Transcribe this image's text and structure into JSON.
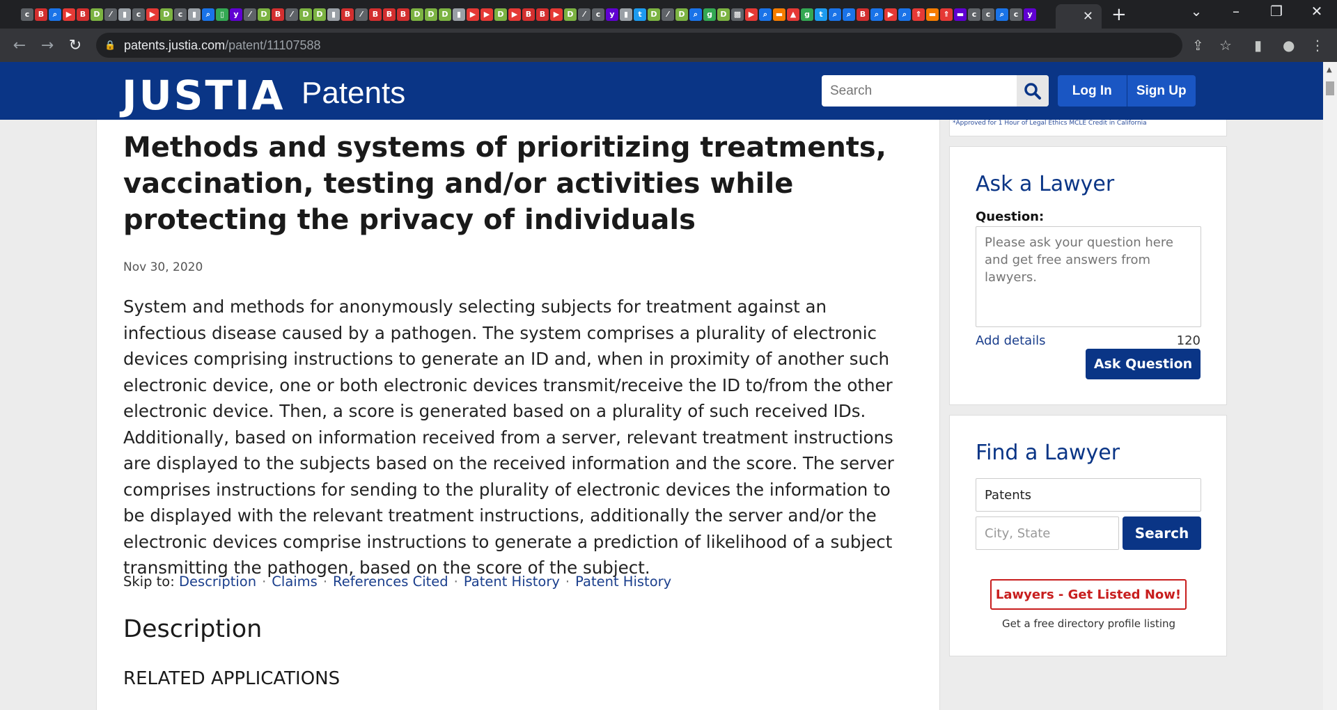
{
  "browser": {
    "tab_icons": [
      {
        "glyph": "c",
        "color": "#5f6368"
      },
      {
        "glyph": "B",
        "color": "#d32f2f"
      },
      {
        "glyph": "⌕",
        "color": "#1a73e8"
      },
      {
        "glyph": "▶",
        "color": "#e53935"
      },
      {
        "glyph": "B",
        "color": "#d32f2f"
      },
      {
        "glyph": "D",
        "color": "#7cb342"
      },
      {
        "glyph": "⁄",
        "color": "#5f6368"
      },
      {
        "glyph": "▮",
        "color": "#9aa0a6"
      },
      {
        "glyph": "c",
        "color": "#5f6368"
      },
      {
        "glyph": "▶",
        "color": "#e53935"
      },
      {
        "glyph": "D",
        "color": "#7cb342"
      },
      {
        "glyph": "c",
        "color": "#5f6368"
      },
      {
        "glyph": "▮",
        "color": "#9aa0a6"
      },
      {
        "glyph": "⌕",
        "color": "#1a73e8"
      },
      {
        "glyph": "▯",
        "color": "#34a853"
      },
      {
        "glyph": "y",
        "color": "#6001d2"
      },
      {
        "glyph": "⁄",
        "color": "#5f6368"
      },
      {
        "glyph": "D",
        "color": "#7cb342"
      },
      {
        "glyph": "B",
        "color": "#d32f2f"
      },
      {
        "glyph": "⁄",
        "color": "#5f6368"
      },
      {
        "glyph": "D",
        "color": "#7cb342"
      },
      {
        "glyph": "D",
        "color": "#7cb342"
      },
      {
        "glyph": "▮",
        "color": "#9aa0a6"
      },
      {
        "glyph": "B",
        "color": "#d32f2f"
      },
      {
        "glyph": "⁄",
        "color": "#5f6368"
      },
      {
        "glyph": "B",
        "color": "#d32f2f"
      },
      {
        "glyph": "B",
        "color": "#d32f2f"
      },
      {
        "glyph": "B",
        "color": "#d32f2f"
      },
      {
        "glyph": "D",
        "color": "#7cb342"
      },
      {
        "glyph": "D",
        "color": "#7cb342"
      },
      {
        "glyph": "D",
        "color": "#7cb342"
      },
      {
        "glyph": "▮",
        "color": "#9aa0a6"
      },
      {
        "glyph": "▶",
        "color": "#e53935"
      },
      {
        "glyph": "▶",
        "color": "#e53935"
      },
      {
        "glyph": "D",
        "color": "#7cb342"
      },
      {
        "glyph": "▶",
        "color": "#e53935"
      },
      {
        "glyph": "B",
        "color": "#d32f2f"
      },
      {
        "glyph": "B",
        "color": "#d32f2f"
      },
      {
        "glyph": "▶",
        "color": "#e53935"
      },
      {
        "glyph": "D",
        "color": "#7cb342"
      },
      {
        "glyph": "⁄",
        "color": "#5f6368"
      },
      {
        "glyph": "c",
        "color": "#5f6368"
      },
      {
        "glyph": "y",
        "color": "#6001d2"
      },
      {
        "glyph": "▮",
        "color": "#9aa0a6"
      },
      {
        "glyph": "t",
        "color": "#1d9bf0"
      },
      {
        "glyph": "D",
        "color": "#7cb342"
      },
      {
        "glyph": "⁄",
        "color": "#5f6368"
      },
      {
        "glyph": "D",
        "color": "#7cb342"
      },
      {
        "glyph": "⌕",
        "color": "#1a73e8"
      },
      {
        "glyph": "g",
        "color": "#34a853"
      },
      {
        "glyph": "D",
        "color": "#7cb342"
      },
      {
        "glyph": "▩",
        "color": "#5f6368"
      },
      {
        "glyph": "▶",
        "color": "#e53935"
      },
      {
        "glyph": "⌕",
        "color": "#1a73e8"
      },
      {
        "glyph": "▬",
        "color": "#f57c00"
      },
      {
        "glyph": "▲",
        "color": "#e53935"
      },
      {
        "glyph": "g",
        "color": "#34a853"
      },
      {
        "glyph": "t",
        "color": "#1d9bf0"
      },
      {
        "glyph": "⌕",
        "color": "#1a73e8"
      },
      {
        "glyph": "⌕",
        "color": "#1a73e8"
      },
      {
        "glyph": "B",
        "color": "#d32f2f"
      },
      {
        "glyph": "⌕",
        "color": "#1a73e8"
      },
      {
        "glyph": "▶",
        "color": "#e53935"
      },
      {
        "glyph": "⌕",
        "color": "#1a73e8"
      },
      {
        "glyph": "⇑",
        "color": "#e53935"
      },
      {
        "glyph": "▬",
        "color": "#f57c00"
      },
      {
        "glyph": "⇑",
        "color": "#e53935"
      },
      {
        "glyph": "▬",
        "color": "#6001d2"
      },
      {
        "glyph": "c",
        "color": "#5f6368"
      },
      {
        "glyph": "c",
        "color": "#5f6368"
      },
      {
        "glyph": "⌕",
        "color": "#1a73e8"
      },
      {
        "glyph": "c",
        "color": "#5f6368"
      },
      {
        "glyph": "y",
        "color": "#6001d2"
      }
    ],
    "url_host": "patents.justia.com",
    "url_path": "/patent/11107588"
  },
  "header": {
    "logo": "JUSTIA",
    "logo_sub": "Patents",
    "search_placeholder": "Search",
    "login": "Log In",
    "signup": "Sign Up"
  },
  "patent": {
    "title": "Methods and systems of prioritizing treatments, vaccination, testing and/or activities while protecting the privacy of individuals",
    "date": "Nov 30, 2020",
    "abstract": "System and methods for anonymously selecting subjects for treatment against an infectious disease caused by a pathogen. The system comprises a plurality of electronic devices comprising instructions to generate an ID and, when in proximity of another such electronic device, one or both electronic devices transmit/receive the ID to/from the other electronic device. Then, a score is generated based on a plurality of such received IDs. Additionally, based on information received from a server, relevant treatment instructions are displayed to the subjects based on the received information and the score. The server comprises instructions for sending to the plurality of electronic devices the information to be displayed with the relevant treatment instructions, additionally the server and/or the electronic devices comprise instructions to generate a prediction of likelihood of a subject transmitting the pathogen, based on the score of the subject.",
    "skip_label": "Skip to:",
    "skip_links": [
      "Description",
      "Claims",
      "References Cited",
      "Patent History",
      "Patent History"
    ],
    "section_heading": "Description",
    "subsection_heading": "RELATED APPLICATIONS"
  },
  "sidebar": {
    "ad_text": "*Approved for 1 Hour of Legal Ethics MCLE Credit in California",
    "ask": {
      "title": "Ask a Lawyer",
      "question_label": "Question:",
      "question_placeholder": "Please ask your question here and get free answers from lawyers.",
      "add_details": "Add details",
      "char_count": "120",
      "button": "Ask Question"
    },
    "find": {
      "title": "Find a Lawyer",
      "practice_value": "Patents",
      "location_placeholder": "City, State",
      "button": "Search",
      "listed_button": "Lawyers - Get Listed Now!",
      "listed_sub": "Get a free directory profile listing"
    }
  }
}
